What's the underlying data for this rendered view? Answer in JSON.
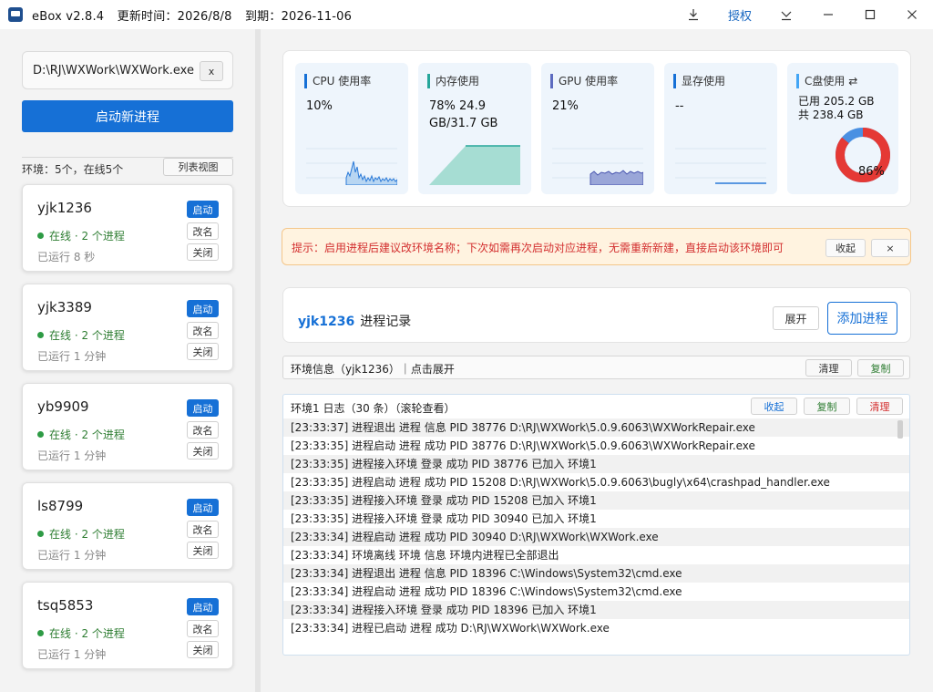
{
  "titlebar": {
    "app": "eBox v2.8.4",
    "updated": "更新时间：2026/8/8",
    "expires": "到期：2026-11-06",
    "auth_label": "授权"
  },
  "sidebar": {
    "path_value": "D:\\RJ\\WXWork\\WXWork.exe",
    "clear_label": "x",
    "start_label": "启动新进程",
    "env_summary": "环境：5个，在线5个",
    "list_view_label": "列表视图",
    "envs": [
      {
        "name": "yjk1236",
        "status": "在线 · 2 个进程",
        "uptime": "已运行 8 秒",
        "btn_start": "启动",
        "btn_rename": "改名",
        "btn_close": "关闭"
      },
      {
        "name": "yjk3389",
        "status": "在线 · 2 个进程",
        "uptime": "已运行 1 分钟",
        "btn_start": "启动",
        "btn_rename": "改名",
        "btn_close": "关闭"
      },
      {
        "name": "yb9909",
        "status": "在线 · 2 个进程",
        "uptime": "已运行 1 分钟",
        "btn_start": "启动",
        "btn_rename": "改名",
        "btn_close": "关闭"
      },
      {
        "name": "ls8799",
        "status": "在线 · 2 个进程",
        "uptime": "已运行 1 分钟",
        "btn_start": "启动",
        "btn_rename": "改名",
        "btn_close": "关闭"
      },
      {
        "name": "tsq5853",
        "status": "在线 · 2 个进程",
        "uptime": "已运行 1 分钟",
        "btn_start": "启动",
        "btn_rename": "改名",
        "btn_close": "关闭"
      }
    ]
  },
  "stats": {
    "cpu": {
      "label": "CPU 使用率",
      "value": "10%"
    },
    "mem": {
      "label": "内存使用",
      "value": "78%  24.9 GB/31.7 GB"
    },
    "gpu": {
      "label": "GPU 使用率",
      "value": "21%"
    },
    "vram": {
      "label": "显存使用",
      "value": "--"
    },
    "disk": {
      "label": "C盘使用 ⇄",
      "used": "已用 205.2 GB",
      "total": "共 238.4 GB",
      "percent_text": "86%",
      "percent": 86
    }
  },
  "hint": {
    "text": "提示：启用进程后建议改环境名称；下次如需再次启动对应进程，无需重新新建，直接启动该环境即可",
    "collapse_label": "收起",
    "close_label": "×"
  },
  "record": {
    "env_name": "yjk1236",
    "title": "进程记录",
    "expand_label": "展开",
    "add_label": "添加进程"
  },
  "envinfo": {
    "text": "环境信息（yjk1236）｜点击展开",
    "clear_label": "清理",
    "copy_label": "复制"
  },
  "log": {
    "head": "环境1 日志（30 条）（滚轮查看）",
    "collapse_label": "收起",
    "copy_label": "复制",
    "clear_label": "清理",
    "rows": [
      "[23:33:37] 进程退出 进程 信息 PID 38776 D:\\RJ\\WXWork\\5.0.9.6063\\WXWorkRepair.exe",
      "[23:33:35] 进程启动 进程 成功 PID 38776 D:\\RJ\\WXWork\\5.0.9.6063\\WXWorkRepair.exe",
      "[23:33:35] 进程接入环境 登录 成功 PID 38776 已加入 环境1",
      "[23:33:35] 进程启动 进程 成功 PID 15208 D:\\RJ\\WXWork\\5.0.9.6063\\bugly\\x64\\crashpad_handler.exe",
      "[23:33:35] 进程接入环境 登录 成功 PID 15208 已加入 环境1",
      "[23:33:35] 进程接入环境 登录 成功 PID 30940 已加入 环境1",
      "[23:33:34] 进程启动 进程 成功 PID 30940 D:\\RJ\\WXWork\\WXWork.exe",
      "[23:33:34] 环境离线 环境 信息 环境内进程已全部退出",
      "[23:33:34] 进程退出 进程 信息 PID 18396 C:\\Windows\\System32\\cmd.exe",
      "[23:33:34] 进程启动 进程 成功 PID 18396 C:\\Windows\\System32\\cmd.exe",
      "[23:33:34] 进程接入环境 登录 成功 PID 18396 已加入 环境1",
      "[23:33:34] 进程已启动 进程 成功 D:\\RJ\\WXWork\\WXWork.exe"
    ]
  },
  "colors": {
    "accent": "#1670d6",
    "online": "#2e9b45",
    "disk_used": "#e53935",
    "disk_free": "#4a90e2"
  }
}
